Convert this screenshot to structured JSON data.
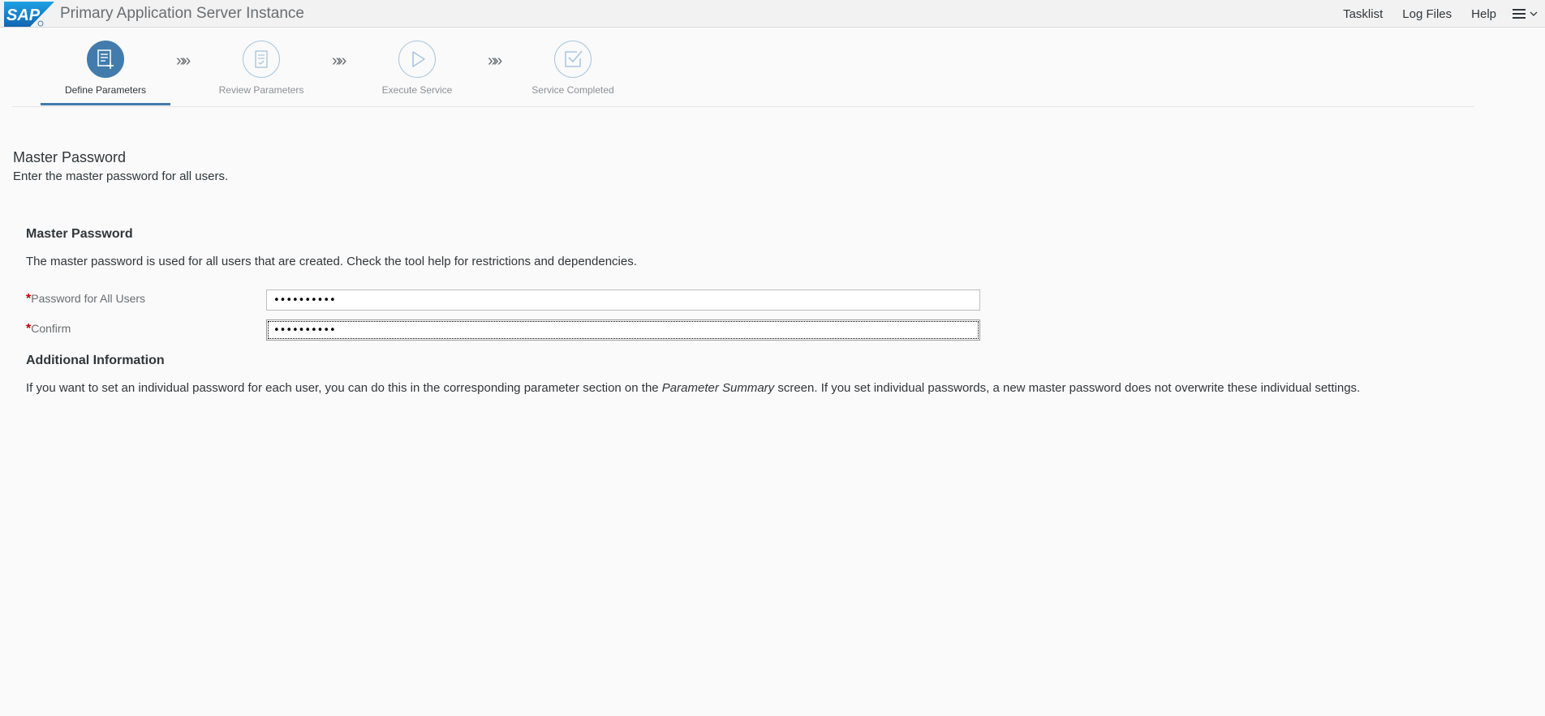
{
  "header": {
    "logo_text": "SAP",
    "title": "Primary Application Server Instance",
    "links": [
      "Tasklist",
      "Log Files",
      "Help"
    ],
    "menu_icon": "hamburger-menu-icon"
  },
  "wizard": {
    "steps": [
      {
        "label": "Define Parameters",
        "icon": "form-list-add-icon",
        "state": "active"
      },
      {
        "label": "Review Parameters",
        "icon": "clipboard-check-icon",
        "state": "inactive"
      },
      {
        "label": "Execute Service",
        "icon": "play-icon",
        "state": "inactive"
      },
      {
        "label": "Service Completed",
        "icon": "checkbox-checked-icon",
        "state": "inactive"
      }
    ],
    "separator": "»»"
  },
  "page": {
    "title": "Master Password",
    "description": "Enter the master password for all users."
  },
  "group": {
    "title": "Master Password",
    "description": "The master password is used for all users that are created. Check the tool help for restrictions and dependencies.",
    "fields": [
      {
        "label": "Password for All Users",
        "required_marker": "*",
        "value": "••••••••••"
      },
      {
        "label": "Confirm",
        "required_marker": "*",
        "value": "••••••••••"
      }
    ]
  },
  "additional": {
    "title": "Additional Information",
    "text_before": "If you want to set an individual password for each user, you can do this in the corresponding parameter section on the ",
    "text_italic": "Parameter Summary",
    "text_after": " screen. If you set individual passwords, a new master password does not overwrite these individual settings."
  },
  "colors": {
    "accent": "#427cac",
    "required": "#bb0000",
    "header_bg": "#f2f2f2",
    "page_bg": "#fafafa"
  }
}
